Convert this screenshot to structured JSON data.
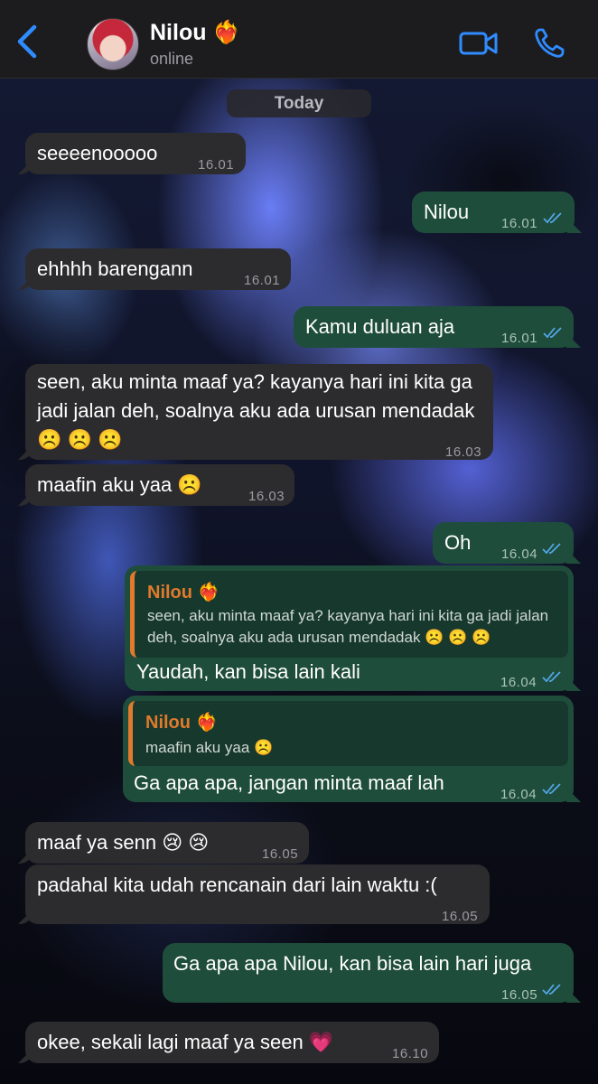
{
  "header": {
    "back_label": "‹",
    "contact_name": "Nilou ❤️‍🔥",
    "status": "online",
    "video_icon": "video-camera-icon",
    "call_icon": "phone-icon"
  },
  "date_label": "Today",
  "colors": {
    "header_bg": "#1c1c1e",
    "incoming_bubble": "#2c2c2e",
    "outgoing_bubble": "#1f4d3b",
    "accent_blue": "#2f8cff",
    "reply_name": "#e07a2c",
    "read_ticks": "#53a6e8"
  },
  "messages": [
    {
      "dir": "in",
      "text": "seeeenooooo",
      "time": "16.01"
    },
    {
      "dir": "out",
      "text": "Nilou",
      "time": "16.01"
    },
    {
      "dir": "in",
      "text": "ehhhh barengann",
      "time": "16.01"
    },
    {
      "dir": "out",
      "text": "Kamu duluan aja",
      "time": "16.01"
    },
    {
      "dir": "in",
      "text": "seen, aku minta maaf ya? kayanya hari ini kita ga jadi jalan deh, soalnya aku ada urusan mendadak ☹️ ☹️ ☹️",
      "time": "16.03"
    },
    {
      "dir": "in",
      "text": "maafin aku yaa ☹️",
      "time": "16.03"
    },
    {
      "dir": "out",
      "text": "Oh",
      "time": "16.04"
    },
    {
      "dir": "out",
      "text": "Yaudah, kan bisa lain kali",
      "time": "16.04",
      "reply": {
        "name": "Nilou ❤️‍🔥",
        "text": "seen, aku minta maaf ya? kayanya hari ini kita ga jadi jalan deh, soalnya aku ada urusan mendadak ☹️ ☹️ ☹️"
      }
    },
    {
      "dir": "out",
      "text": "Ga apa apa, jangan minta maaf lah",
      "time": "16.04",
      "reply": {
        "name": "Nilou ❤️‍🔥",
        "text": "maafin aku yaa ☹️"
      }
    },
    {
      "dir": "in",
      "text": "maaf ya senn 😢 😢",
      "time": "16.05"
    },
    {
      "dir": "in",
      "text": "padahal kita udah rencanain dari lain waktu :(",
      "time": "16.05"
    },
    {
      "dir": "out",
      "text": "Ga apa apa Nilou, kan bisa lain hari juga",
      "time": "16.05"
    },
    {
      "dir": "in",
      "text": "okee, sekali lagi maaf ya seen 💗",
      "time": "16.10"
    }
  ]
}
